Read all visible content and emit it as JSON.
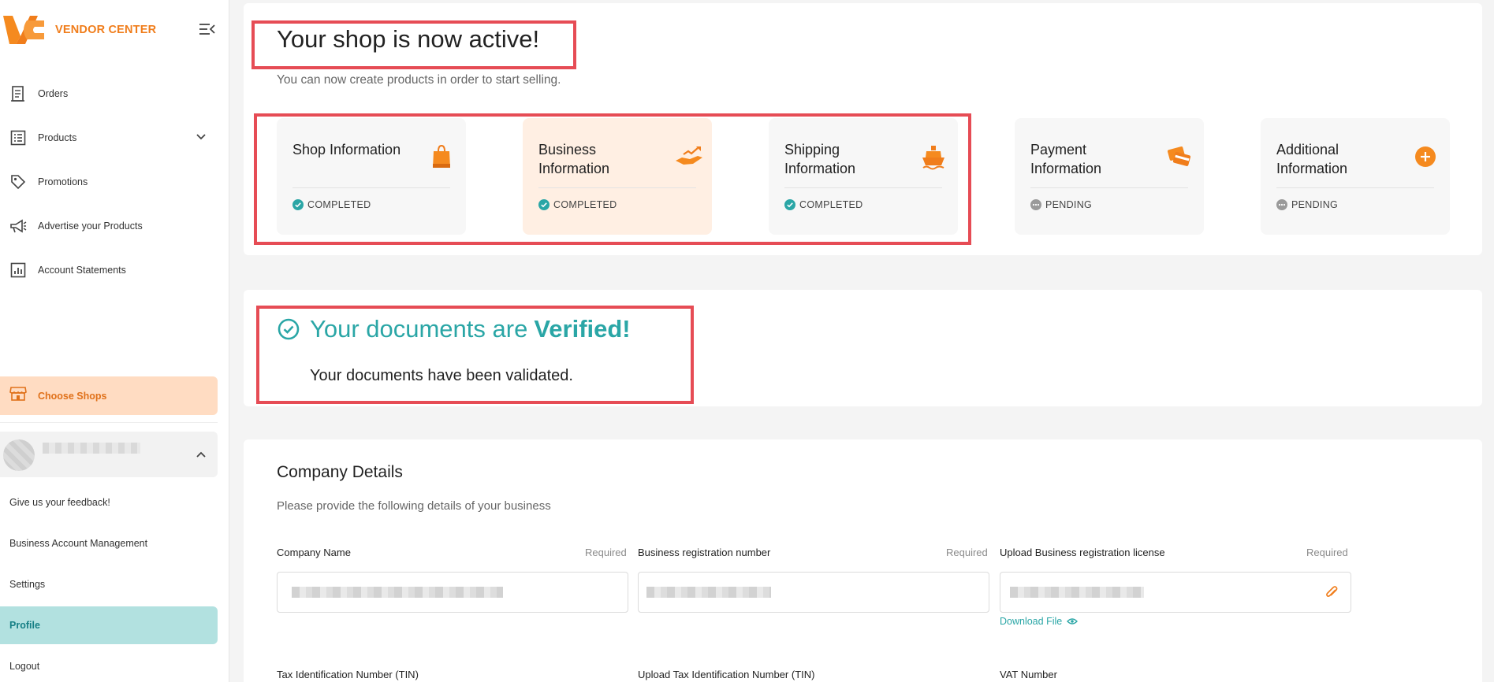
{
  "brand": {
    "name": "VENDOR CENTER",
    "color": "#f07d1b"
  },
  "sidebar": {
    "nav": [
      {
        "label": "Orders",
        "icon": "receipt-icon"
      },
      {
        "label": "Products",
        "icon": "list-icon",
        "expandable": true
      },
      {
        "label": "Promotions",
        "icon": "tag-icon"
      },
      {
        "label": "Advertise your Products",
        "icon": "megaphone-icon"
      },
      {
        "label": "Account Statements",
        "icon": "statement-icon"
      }
    ],
    "choose_shops": "Choose Shops",
    "links": {
      "feedback": "Give us your feedback!",
      "business_account": "Business Account Management",
      "settings": "Settings",
      "profile": "Profile",
      "logout": "Logout"
    }
  },
  "shop": {
    "title": "Your shop is now active!",
    "subtitle": "You can now create products in order to start selling."
  },
  "cards": [
    {
      "title": "Shop Information",
      "status": "COMPLETED",
      "icon": "shopping-bag-icon"
    },
    {
      "title": "Business Information",
      "status": "COMPLETED",
      "icon": "handshake-icon"
    },
    {
      "title": "Shipping Information",
      "status": "COMPLETED",
      "icon": "ship-icon"
    },
    {
      "title": "Payment Information",
      "status": "PENDING",
      "icon": "payment-cards-icon"
    },
    {
      "title": "Additional Information",
      "status": "PENDING",
      "icon": "plus-circle-icon"
    }
  ],
  "verification": {
    "title_prefix": "Your documents are",
    "title_strong": "Verified!",
    "subtitle": "Your documents have been validated."
  },
  "company": {
    "title": "Company Details",
    "subtitle": "Please provide the following details of your business",
    "required_label": "Required",
    "fields": {
      "name": "Company Name",
      "reg_number": "Business registration number",
      "reg_license": "Upload Business registration license",
      "tin": "Tax Identification Number (TIN)",
      "tin_upload": "Upload Tax Identification Number (TIN)",
      "vat": "VAT Number"
    },
    "download_file": "Download File"
  },
  "colors": {
    "accent_orange": "#f07d1b",
    "teal": "#2aa6a6",
    "highlight_red": "#e64c55",
    "profile_bg": "#b2e1e0"
  }
}
